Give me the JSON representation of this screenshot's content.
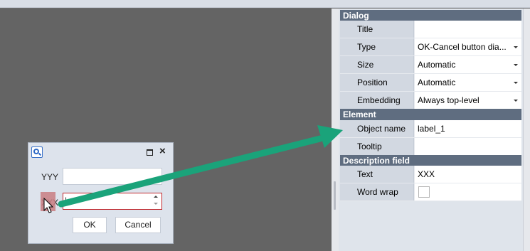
{
  "dialog_preview": {
    "label_yyy": "YYY",
    "label_xxx": "XXX",
    "input_text": "|",
    "ok_label": "OK",
    "cancel_label": "Cancel",
    "icon": "search-icon"
  },
  "properties": {
    "sections": [
      {
        "title": "Dialog",
        "rows": [
          {
            "label": "Title",
            "value": ""
          },
          {
            "label": "Type",
            "value": "OK-Cancel button dia...",
            "dropdown": true
          },
          {
            "label": "Size",
            "value": "Automatic",
            "dropdown": true
          },
          {
            "label": "Position",
            "value": "Automatic",
            "dropdown": true
          },
          {
            "label": "Embedding",
            "value": "Always top-level",
            "dropdown": true
          }
        ]
      },
      {
        "title": "Element",
        "rows": [
          {
            "label": "Object name",
            "value": "label_1"
          },
          {
            "label": "Tooltip",
            "value": ""
          }
        ]
      },
      {
        "title": "Description field",
        "rows": [
          {
            "label": "Text",
            "value": "XXX"
          },
          {
            "label": "Word wrap",
            "checkbox": true,
            "checked": false
          }
        ]
      }
    ]
  },
  "colors": {
    "section_header": "#5f6d80",
    "annotation_arrow": "#1aa37a",
    "error_border": "#c0282d",
    "highlight": "#c97e82"
  }
}
